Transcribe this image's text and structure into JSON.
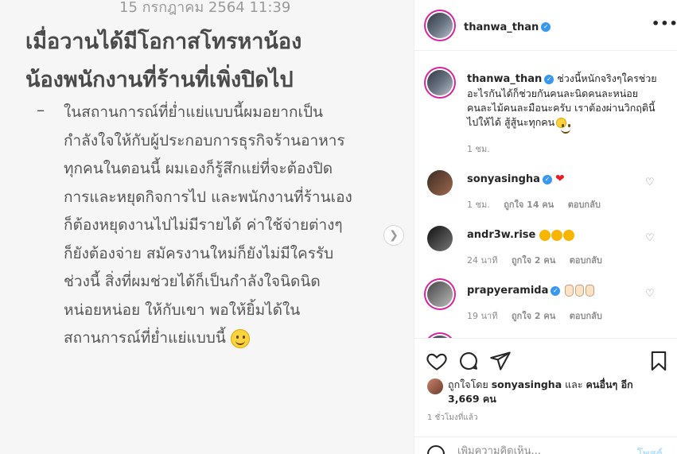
{
  "image": {
    "date": "15 กรกฎาคม 2564 11:39",
    "headline": [
      "เมื่อวานได้มีโอกาสโทรหาน้อง",
      "น้องพนักงานที่ร้านที่เพิ่งปิดไป"
    ],
    "bullet": "–",
    "body": [
      "ในสถานการณ์ที่ย่ำแย่แบบนี้ผมอยากเป็น",
      "กำลังใจให้กับผู้ประกอบการธุรกิจร้านอาหาร",
      "ทุกคนในตอนนี้ ผมเองก็รู้สึกแย่ที่จะต้องปิด",
      "การและหยุดกิจการไป และพนักงานที่ร้านเอง",
      "ก็ต้องหยุดงานไปไม่มีรายได้ ค่าใช้จ่ายต่างๆ",
      "ก็ยังต้องจ่าย สมัครงานใหม่ก็ยังไม่มีใครรับ",
      "ช่วงนี้ สิ่งที่ผมช่วยได้ก็เป็นกำลังใจนิดนิด",
      "หน่อยหน่อย ให้กับเขา พอให้ยิ้มได้ใน",
      "สถานการณ์ที่ย่ำแย่แบบนี้"
    ],
    "next_icon": "chevron-right-icon"
  },
  "post": {
    "author": "thanwa_than",
    "more_icon": "more-options-icon",
    "caption": {
      "author": "thanwa_than",
      "text": "ช่วงนี้หนักจริงๆใครช่วยอะไรกันได้ก็ช่วยกันคนละนิดคนละหน่อยคนละไม้คนละมือนะครับ เราต้องผ่านวิกฤตินี้ไปให้ได้ สู้สู้นะทุกคน",
      "time": "1 ชม."
    },
    "comments": [
      {
        "user": "sonyasingha",
        "verified": true,
        "time": "1 ชม.",
        "likes": "ถูกใจ 14 คน",
        "reply": "ตอบกลับ"
      },
      {
        "user": "andr3w.rise",
        "verified": false,
        "time": "24 นาที",
        "likes": "ถูกใจ 2 คน",
        "reply": "ตอบกลับ"
      },
      {
        "user": "prapyeramida",
        "verified": true,
        "time": "19 นาที",
        "likes": "ถูกใจ 2 คน",
        "reply": "ตอบกลับ"
      }
    ],
    "liked_by_prefix": "ถูกใจโดย",
    "liked_by_user": "sonyasingha",
    "liked_by_and": "และ",
    "liked_by_others": "คนอื่นๆ อีก 3,669 คน",
    "time_ago": "1 ชั่วโมงที่แล้ว",
    "comment_placeholder": "เพิ่มความคิดเห็น...",
    "post_button": "โพสต์",
    "colors": {
      "verified": "#3897f0",
      "link": "#b2dffc"
    }
  }
}
